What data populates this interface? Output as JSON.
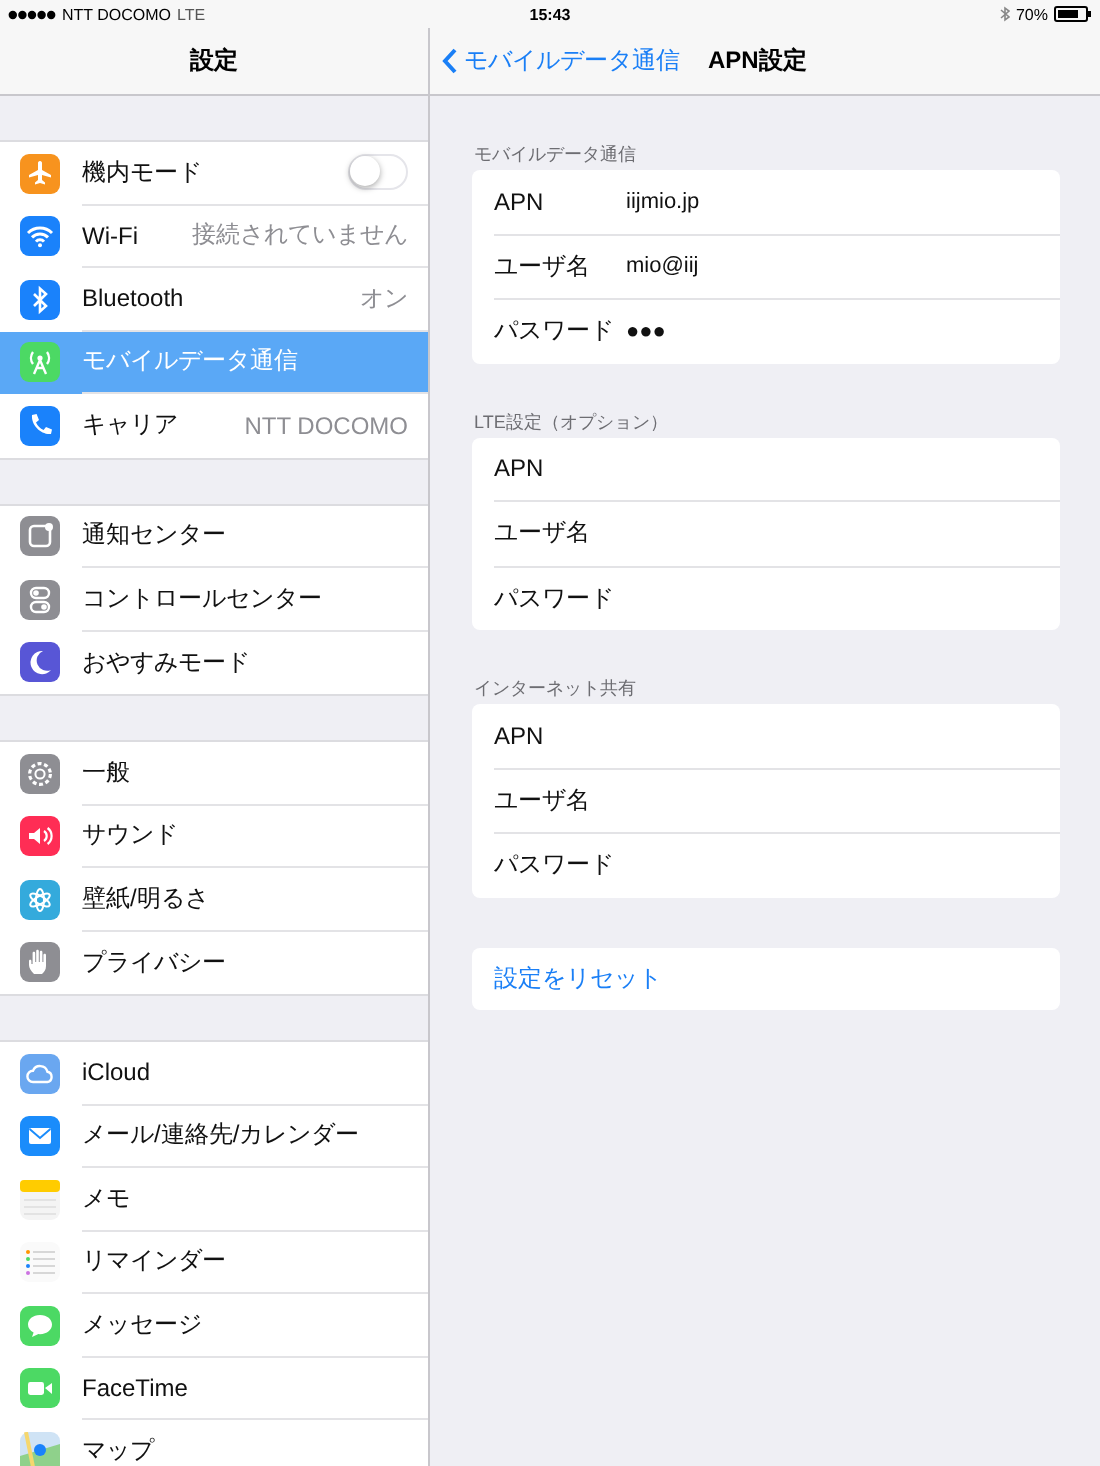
{
  "status_bar": {
    "carrier": "NTT DOCOMO",
    "network": "LTE",
    "time": "15:43",
    "battery": "70%"
  },
  "sidebar": {
    "title": "設定",
    "groups": [
      {
        "items": [
          {
            "kind": "toggle",
            "label": "機内モード",
            "on": false,
            "selected": false
          },
          {
            "kind": "detail",
            "label": "Wi-Fi",
            "value": "接続されていません",
            "selected": false
          },
          {
            "kind": "detail",
            "label": "Bluetooth",
            "value": "オン",
            "selected": false
          },
          {
            "kind": "plain",
            "label": "モバイルデータ通信",
            "selected": true
          },
          {
            "kind": "detail",
            "label": "キャリア",
            "value": "NTT DOCOMO",
            "selected": false
          }
        ]
      },
      {
        "items": [
          {
            "kind": "plain",
            "label": "通知センター",
            "selected": false
          },
          {
            "kind": "plain",
            "label": "コントロールセンター",
            "selected": false
          },
          {
            "kind": "plain",
            "label": "おやすみモード",
            "selected": false
          }
        ]
      },
      {
        "items": [
          {
            "kind": "plain",
            "label": "一般",
            "selected": false
          },
          {
            "kind": "plain",
            "label": "サウンド",
            "selected": false
          },
          {
            "kind": "plain",
            "label": "壁紙/明るさ",
            "selected": false
          },
          {
            "kind": "plain",
            "label": "プライバシー",
            "selected": false
          }
        ]
      },
      {
        "items": [
          {
            "kind": "plain",
            "label": "iCloud",
            "selected": false
          },
          {
            "kind": "plain",
            "label": "メール/連絡先/カレンダー",
            "selected": false
          },
          {
            "kind": "plain",
            "label": "メモ",
            "selected": false
          },
          {
            "kind": "plain",
            "label": "リマインダー",
            "selected": false
          },
          {
            "kind": "plain",
            "label": "メッセージ",
            "selected": false
          },
          {
            "kind": "plain",
            "label": "FaceTime",
            "selected": false
          },
          {
            "kind": "plain",
            "label": "マップ",
            "selected": false
          }
        ]
      }
    ]
  },
  "detail": {
    "back": "モバイルデータ通信",
    "title": "APN設定",
    "sections": [
      {
        "header": "モバイルデータ通信",
        "rows": [
          {
            "label": "APN",
            "value": "iijmio.jp"
          },
          {
            "label": "ユーザ名",
            "value": "mio@iij"
          },
          {
            "label": "パスワード",
            "value": "●●●"
          }
        ]
      },
      {
        "header": "LTE設定（オプション）",
        "rows": [
          {
            "label": "APN"
          },
          {
            "label": "ユーザ名"
          },
          {
            "label": "パスワード"
          }
        ]
      },
      {
        "header": "インターネット共有",
        "rows": [
          {
            "label": "APN"
          },
          {
            "label": "ユーザ名"
          },
          {
            "label": "パスワード"
          }
        ]
      }
    ],
    "reset": "設定をリセット"
  }
}
